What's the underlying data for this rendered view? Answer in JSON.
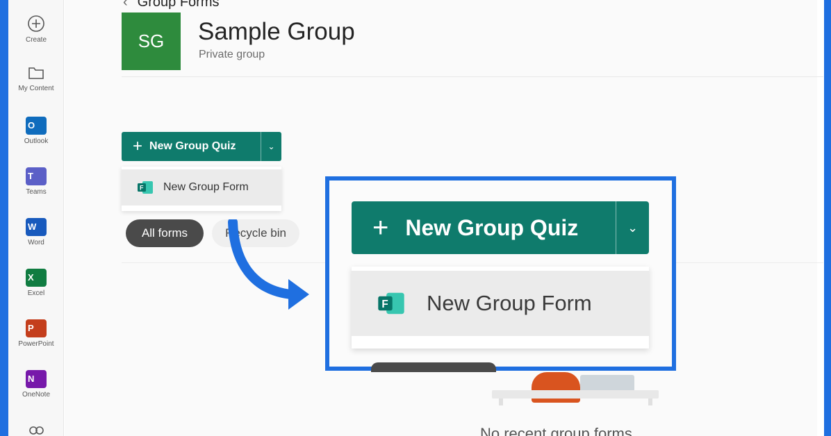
{
  "rail": {
    "items": [
      {
        "label": "Create",
        "icon": "plus-circle-icon"
      },
      {
        "label": "My Content",
        "icon": "folder-icon"
      },
      {
        "label": "Outlook",
        "icon": "outlook-icon",
        "color": "#0f6cbd",
        "letter": "O"
      },
      {
        "label": "Teams",
        "icon": "teams-icon",
        "color": "#5b5fc7",
        "letter": "T"
      },
      {
        "label": "Word",
        "icon": "word-icon",
        "color": "#185abd",
        "letter": "W"
      },
      {
        "label": "Excel",
        "icon": "excel-icon",
        "color": "#107c41",
        "letter": "X"
      },
      {
        "label": "PowerPoint",
        "icon": "powerpoint-icon",
        "color": "#c43e1c",
        "letter": "P"
      },
      {
        "label": "OneNote",
        "icon": "onenote-icon",
        "color": "#7719aa",
        "letter": "N"
      }
    ]
  },
  "breadcrumb": {
    "title": "Group Forms"
  },
  "group": {
    "initials": "SG",
    "name": "Sample Group",
    "subtitle": "Private group",
    "tile_color": "#2e8b3d"
  },
  "new_button": {
    "label": "New Group Quiz",
    "color": "#0f7b6c"
  },
  "dropdown": {
    "item_label": "New Group Form"
  },
  "filters": [
    {
      "label": "All forms",
      "active": true
    },
    {
      "label": "Recycle bin",
      "active": false
    }
  ],
  "empty_state": {
    "text": "No recent group forms"
  },
  "callout": {
    "button_label": "New Group Quiz",
    "menu_item_label": "New Group Form",
    "border_color": "#1f6fe0"
  }
}
